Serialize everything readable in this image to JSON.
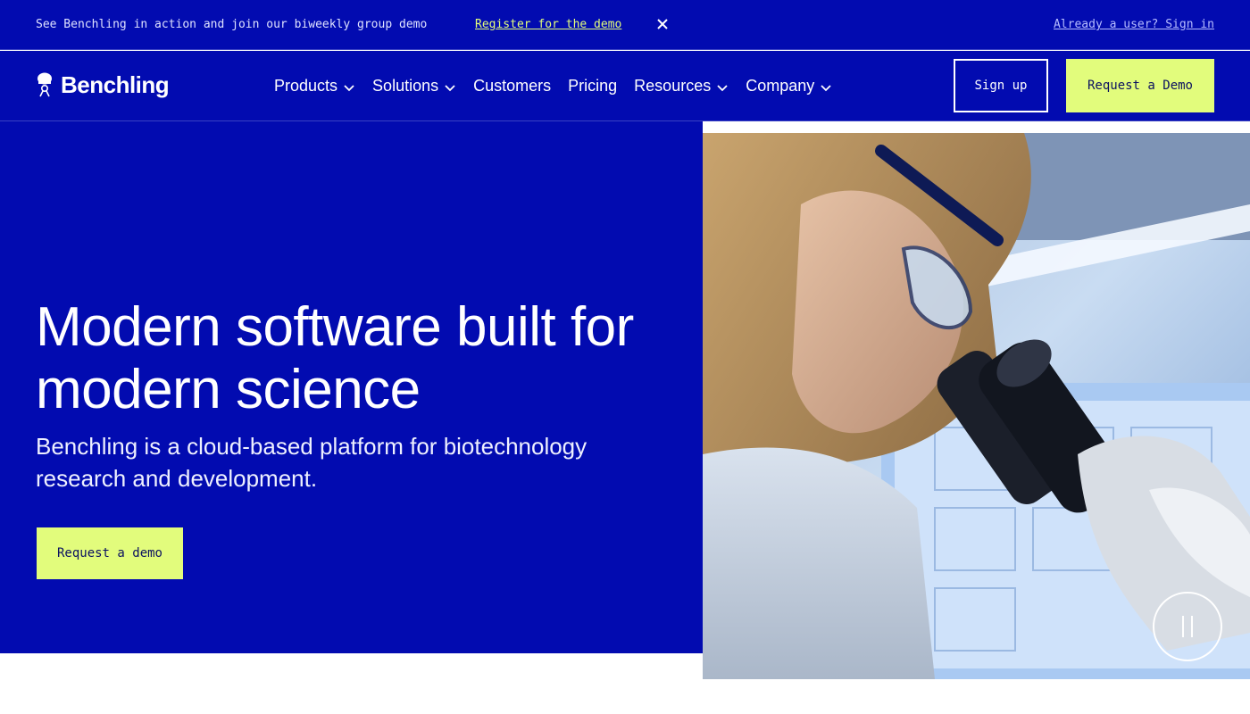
{
  "announcement": {
    "message": "See Benchling in action and join our biweekly group demo",
    "register_link": "Register for the demo",
    "close_icon": "close-icon",
    "signin_link": "Already a user? Sign in"
  },
  "nav": {
    "logo_text": "Benchling",
    "logo_icon": "benchling-logo-icon",
    "items": [
      {
        "label": "Products",
        "dropdown": true
      },
      {
        "label": "Solutions",
        "dropdown": true
      },
      {
        "label": "Customers",
        "dropdown": false
      },
      {
        "label": "Pricing",
        "dropdown": false
      },
      {
        "label": "Resources",
        "dropdown": true
      },
      {
        "label": "Company",
        "dropdown": true
      }
    ],
    "signup_label": "Sign up",
    "demo_label": "Request a Demo"
  },
  "hero": {
    "title": "Modern software built for modern science",
    "subtitle": "Benchling is a cloud-based platform for biotechnology research and development.",
    "cta_label": "Request a demo",
    "media_icon": "pause-icon"
  },
  "colors": {
    "brand_blue": "#020bb0",
    "accent_lime": "#e2fc7c",
    "text_white": "#ffffff"
  }
}
